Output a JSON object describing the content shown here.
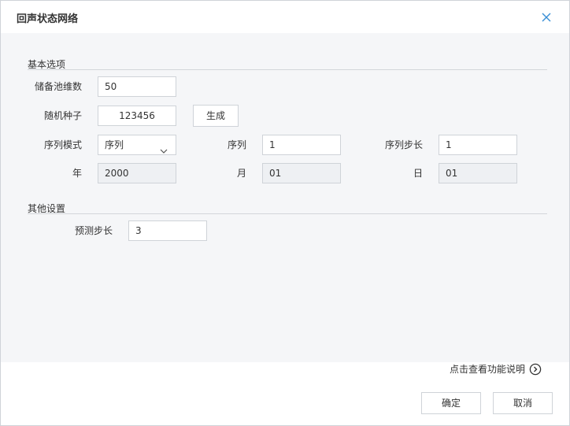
{
  "dialog": {
    "title": "回声状态网络"
  },
  "basic": {
    "section_title": "基本选项",
    "reservoir_dim_label": "储备池维数",
    "reservoir_dim_value": "50",
    "seed_label": "随机种子",
    "seed_value": "123456",
    "generate_label": "生成",
    "seq_mode_label": "序列模式",
    "seq_mode_value": "序列",
    "seq_label": "序列",
    "seq_value": "1",
    "seq_step_label": "序列步长",
    "seq_step_value": "1",
    "year_label": "年",
    "year_value": "2000",
    "month_label": "月",
    "month_value": "01",
    "day_label": "日",
    "day_value": "01"
  },
  "other": {
    "section_title": "其他设置",
    "predict_step_label": "预测步长",
    "predict_step_value": "3"
  },
  "footer": {
    "help_label": "点击查看功能说明",
    "ok_label": "确定",
    "cancel_label": "取消"
  },
  "icons": {
    "close": "close-icon",
    "dropdown": "chevron-down-icon",
    "help": "chevron-right-circle-icon"
  }
}
